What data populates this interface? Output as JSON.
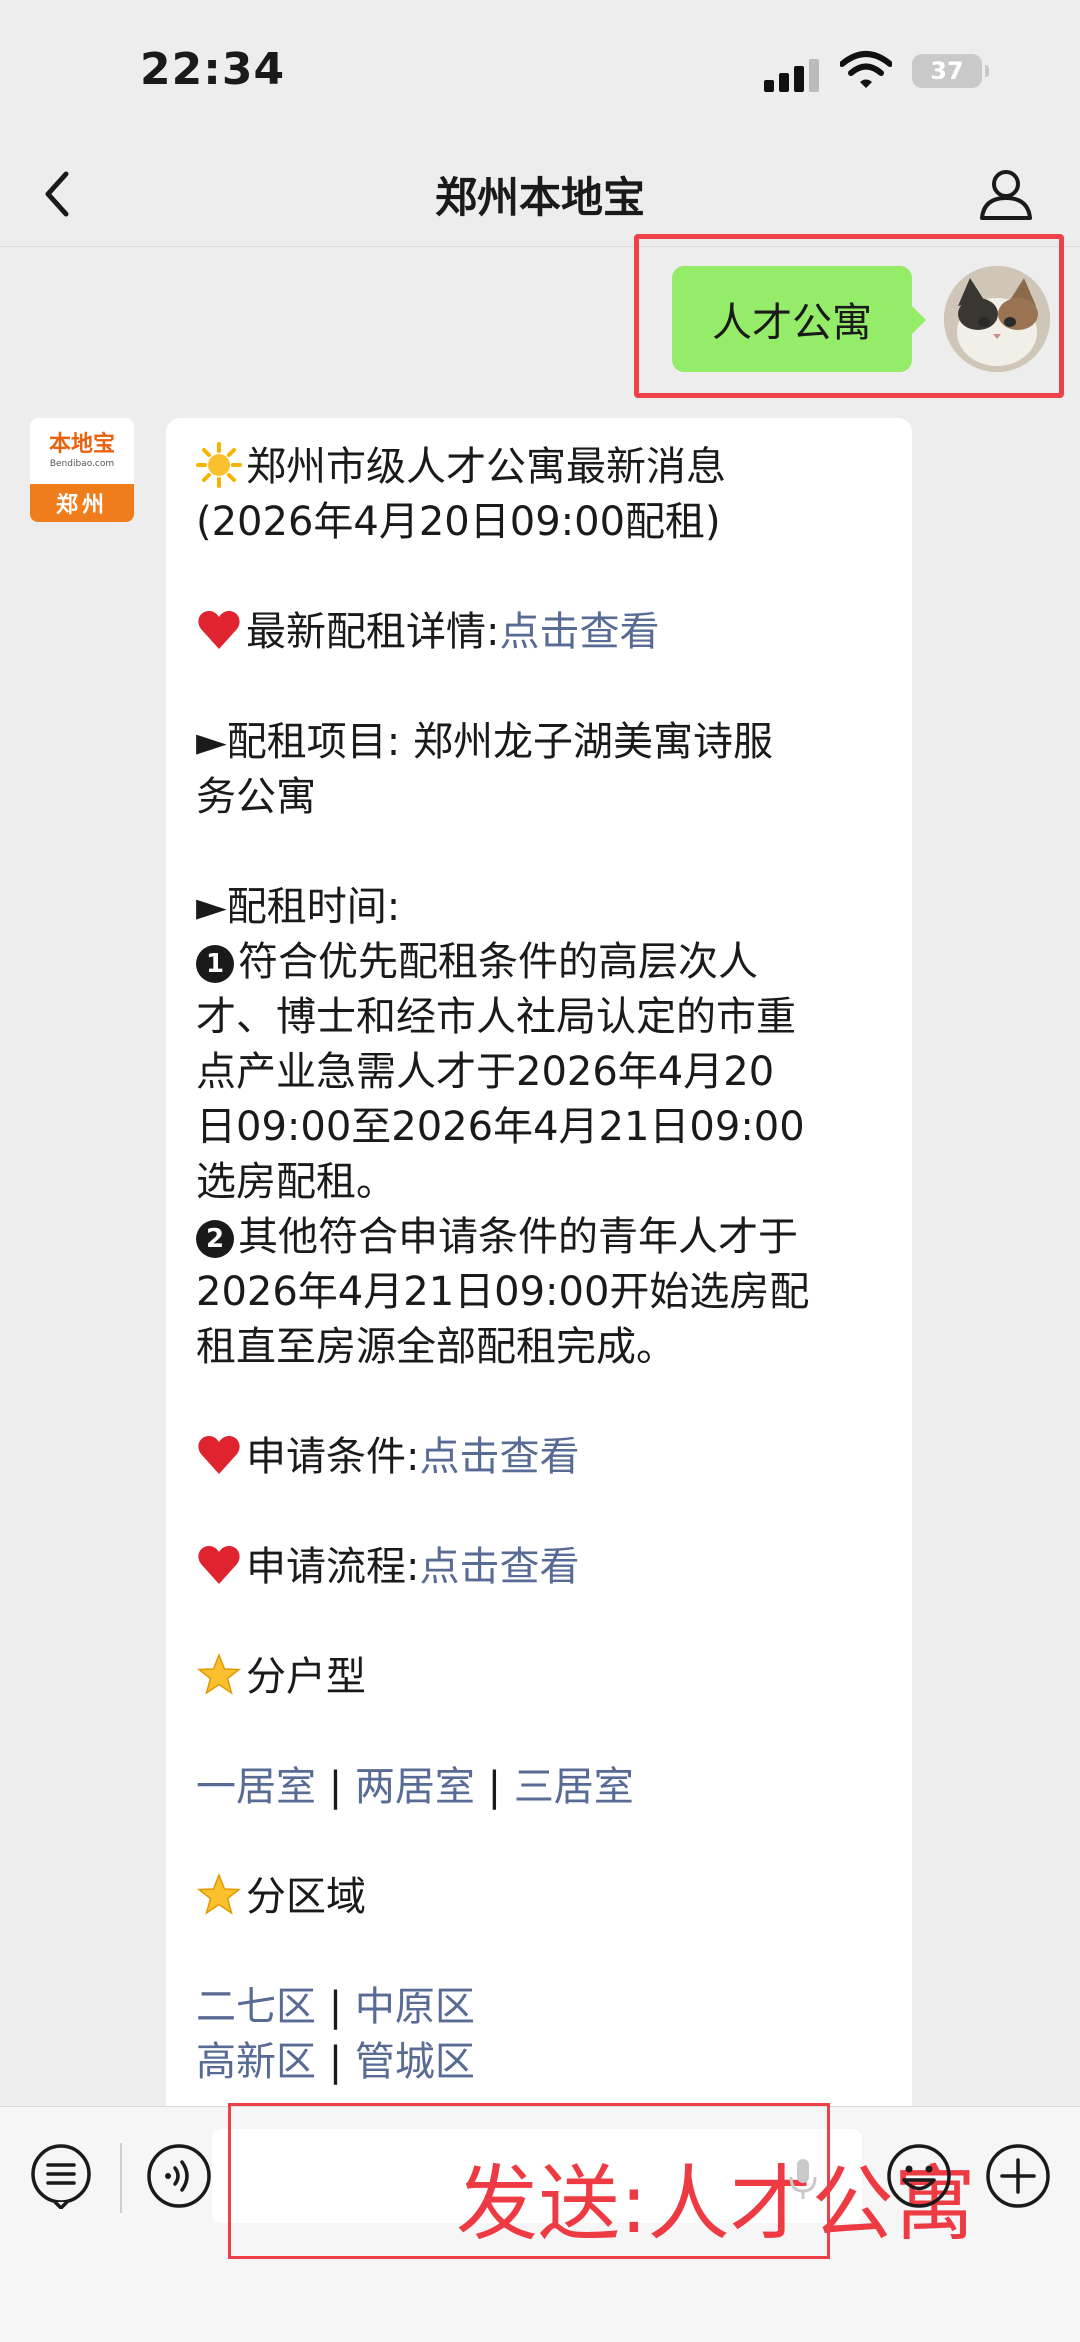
{
  "status_bar": {
    "time": "22:34",
    "battery": "37"
  },
  "nav": {
    "title": "郑州本地宝",
    "back_icon": "chevron-left-icon",
    "profile_icon": "person-icon"
  },
  "sent_message": {
    "text": "人才公寓"
  },
  "official_avatar": {
    "logo_text": "本地宝",
    "logo_sub": "Bendibao.com",
    "city": "郑州"
  },
  "message": {
    "headline": "郑州市级人才公寓最新消息",
    "headline_date": "(2026年4月20日09:00配租)",
    "detail_label": "最新配租详情:",
    "detail_link": "点击查看",
    "project_line1": "►配租项目: 郑州龙子湖美寓诗服",
    "project_line2": "务公寓",
    "time_label": "►配租时间:",
    "item1_num": "1",
    "item1_lines": [
      "符合优先配租条件的高层次人",
      "才、博士和经市人社局认定的市重",
      "点产业急需人才于2026年4月20",
      "日09:00至2026年4月21日09:00",
      "选房配租。"
    ],
    "item2_num": "2",
    "item2_lines": [
      "其他符合申请条件的青年人才于",
      "2026年4月21日09:00开始选房配",
      "租直至房源全部配租完成。"
    ],
    "conditions_label": "申请条件:",
    "conditions_link": "点击查看",
    "process_label": "申请流程:",
    "process_link": "点击查看",
    "room_type_label": "分户型",
    "room_types": [
      "一居室",
      "两居室",
      "三居室"
    ],
    "area_label": "分区域",
    "areas_row1": [
      "二七区",
      "中原区"
    ],
    "areas_row2": [
      "高新区",
      "管城区"
    ],
    "separator": " | "
  },
  "input_bar": {
    "send_label": "发送:人才公寓",
    "icons": [
      "menu-list-icon",
      "voice-icon",
      "microphone-icon",
      "emoji-icon",
      "plus-icon"
    ]
  },
  "colors": {
    "link": "#576b95",
    "sent_bubble": "#95ec69",
    "highlight": "#ee4048",
    "background": "#ededed"
  }
}
